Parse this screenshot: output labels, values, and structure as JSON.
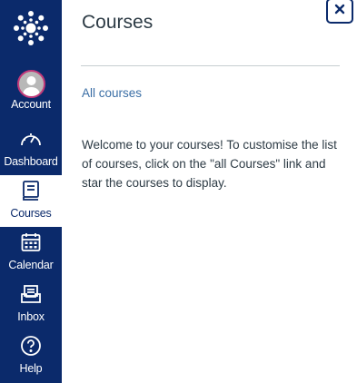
{
  "nav": {
    "logo_icon": "canvas-logo-icon",
    "items": [
      {
        "label": "Account",
        "icon": "avatar-icon"
      },
      {
        "label": "Dashboard",
        "icon": "dashboard-gauge-icon"
      },
      {
        "label": "Courses",
        "icon": "book-icon",
        "active": true
      },
      {
        "label": "Calendar",
        "icon": "calendar-icon"
      },
      {
        "label": "Inbox",
        "icon": "inbox-icon"
      },
      {
        "label": "Help",
        "icon": "help-icon"
      }
    ]
  },
  "tray": {
    "title": "Courses",
    "all_courses_link": "All courses",
    "welcome_text": "Welcome to your courses! To customise the list of courses, click on the \"all Courses\" link and star the courses to display.",
    "close_icon": "close-icon"
  },
  "colors": {
    "nav_bg": "#0b2a6b",
    "link": "#3a6ea5",
    "text": "#2d3b45",
    "avatar_ring": "#c2397a"
  }
}
